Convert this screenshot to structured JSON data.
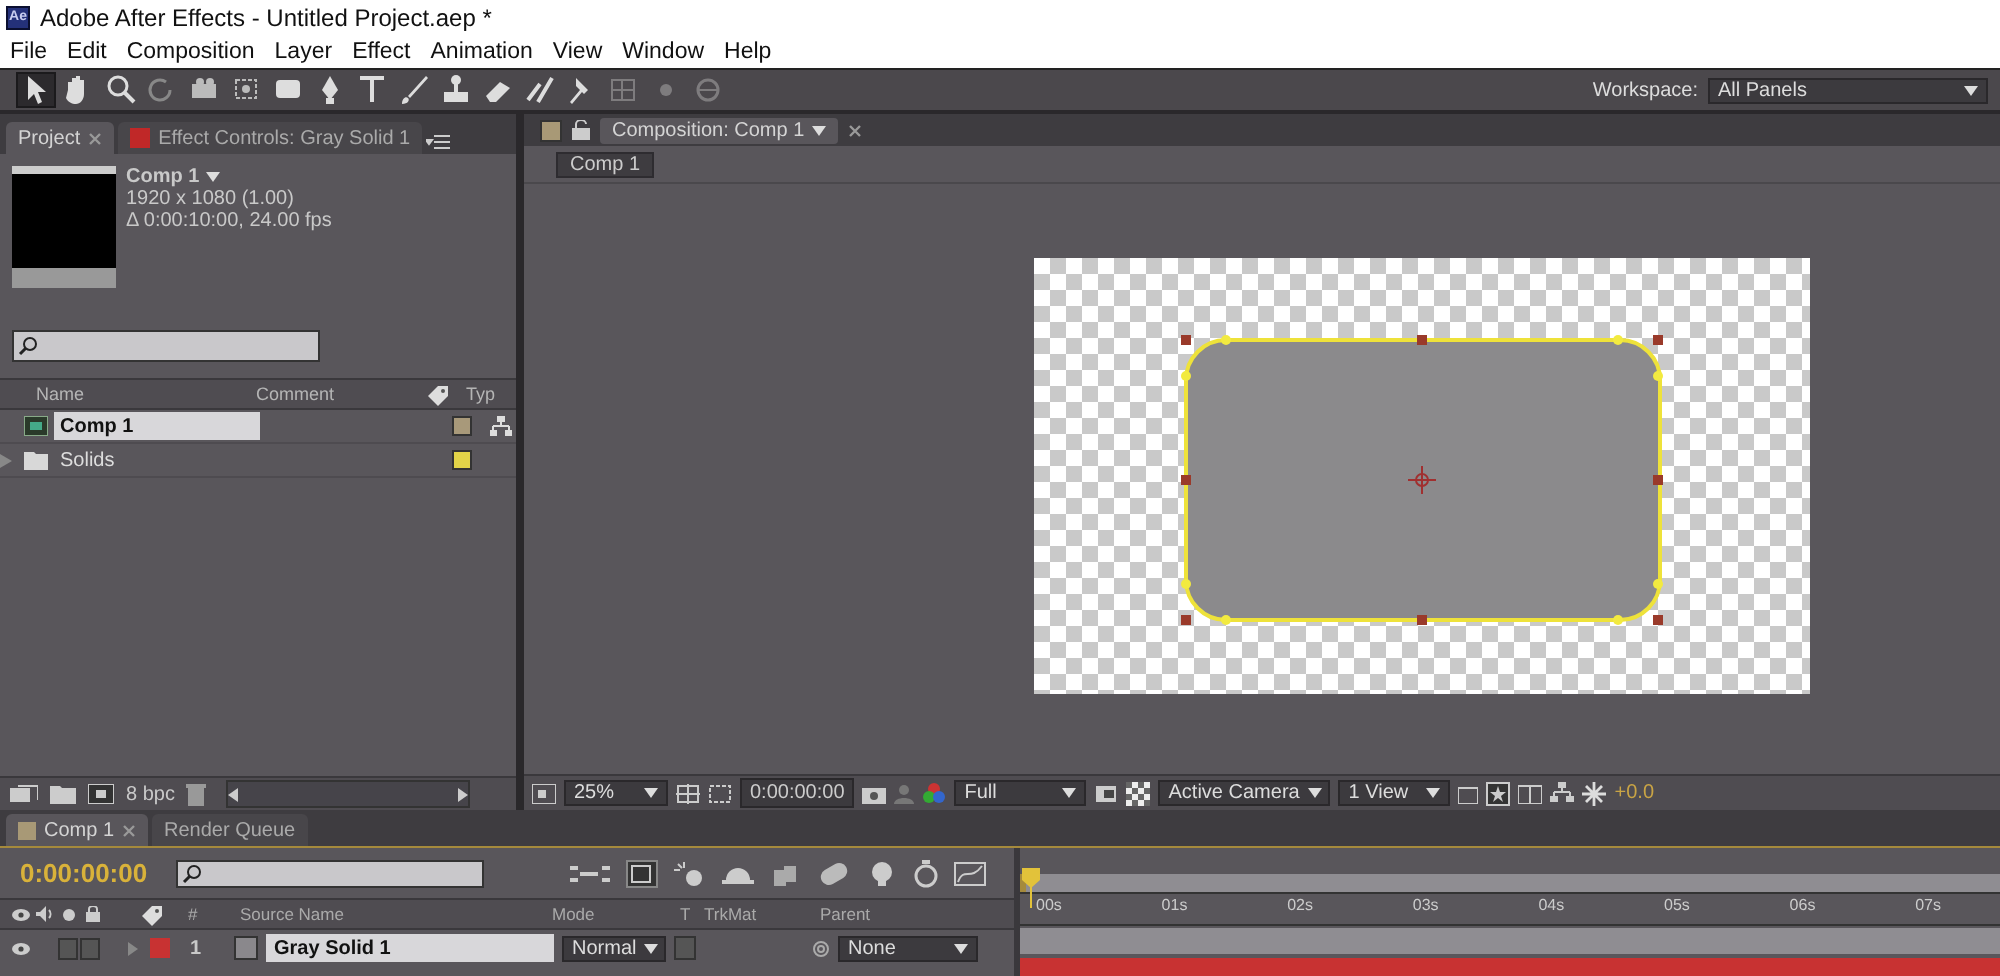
{
  "window": {
    "logo": "Ae",
    "title": "Adobe After Effects - Untitled Project.aep *"
  },
  "menu": [
    "File",
    "Edit",
    "Composition",
    "Layer",
    "Effect",
    "Animation",
    "View",
    "Window",
    "Help"
  ],
  "tools": [
    {
      "kind": "arrow",
      "selected": true,
      "disabled": false
    },
    {
      "kind": "hand",
      "selected": false,
      "disabled": false
    },
    {
      "kind": "zoom",
      "selected": false,
      "disabled": false
    },
    {
      "kind": "rotate",
      "selected": false,
      "disabled": false
    },
    {
      "kind": "camera",
      "selected": false,
      "disabled": false
    },
    {
      "kind": "pan",
      "selected": false,
      "disabled": false
    },
    {
      "kind": "rectangle",
      "selected": false,
      "disabled": false
    },
    {
      "kind": "pen",
      "selected": false,
      "disabled": false
    },
    {
      "kind": "text",
      "selected": false,
      "disabled": false
    },
    {
      "kind": "brush",
      "selected": false,
      "disabled": false
    },
    {
      "kind": "stamp",
      "selected": false,
      "disabled": false
    },
    {
      "kind": "eraser",
      "selected": false,
      "disabled": false
    },
    {
      "kind": "roto",
      "selected": false,
      "disabled": false
    },
    {
      "kind": "pin",
      "selected": false,
      "disabled": false
    },
    {
      "kind": "axis",
      "selected": false,
      "disabled": true
    },
    {
      "kind": "dot",
      "selected": false,
      "disabled": true
    },
    {
      "kind": "world",
      "selected": false,
      "disabled": true
    }
  ],
  "workspace": {
    "label": "Workspace:",
    "value": "All Panels"
  },
  "project_panel": {
    "tabs": [
      {
        "label": "Project",
        "selected": true
      },
      {
        "label": "Effect Controls: Gray Solid 1",
        "selected": false
      }
    ],
    "preview": {
      "name": "Comp 1",
      "resolution": "1920 x 1080 (1.00)",
      "duration": "Δ 0:00:10:00, 24.00 fps"
    },
    "columns": {
      "name": "Name",
      "comment": "Comment",
      "type": "Typ"
    },
    "items": [
      {
        "kind": "composition",
        "name": "Comp 1",
        "selected": true,
        "color": "#a8997a"
      },
      {
        "kind": "folder",
        "name": "Solids",
        "selected": false,
        "color": "#e2d448"
      }
    ],
    "bit_depth": "8 bpc"
  },
  "composition_panel": {
    "tab": "Composition: Comp 1",
    "breadcrumb": "Comp 1",
    "controls": {
      "zoom": "25%",
      "timecode": "0:00:00:00",
      "resolution": "Full",
      "camera": "Active Camera",
      "views": "1 View",
      "exposure": "+0.0"
    }
  },
  "timeline": {
    "tabs": [
      {
        "label": "Comp 1",
        "selected": true
      },
      {
        "label": "Render Queue",
        "selected": false
      }
    ],
    "current_time": "0:00:00:00",
    "columns": {
      "number": "#",
      "source_name": "Source Name",
      "mode": "Mode",
      "t": "T",
      "track_matte": "TrkMat",
      "parent": "Parent"
    },
    "ruler": [
      "00s",
      "01s",
      "02s",
      "03s",
      "04s",
      "05s",
      "06s",
      "07s"
    ],
    "layers": [
      {
        "number": "1",
        "name": "Gray Solid 1",
        "selected": true,
        "color": "#c83232",
        "mode": "Normal",
        "parent": "None"
      }
    ]
  }
}
